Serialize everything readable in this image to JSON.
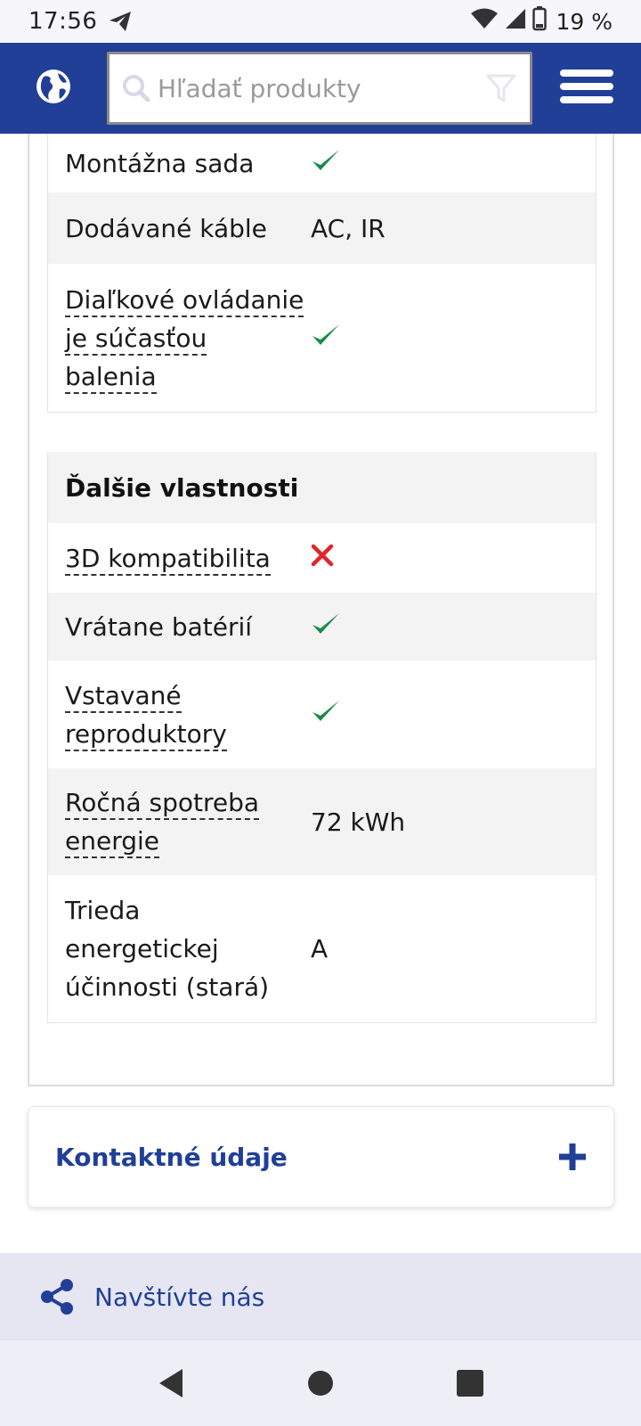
{
  "status_bar": {
    "time": "17:56",
    "battery": "19 %"
  },
  "header": {
    "search_placeholder": "Hľadať produkty",
    "brand_color": "#213f97"
  },
  "table1": {
    "rows": [
      {
        "label": "Montážna sada",
        "value": "check"
      },
      {
        "label": "Dodávané káble",
        "value": "AC, IR"
      },
      {
        "label_lines": [
          "Diaľkové ovládanie",
          "je súčasťou",
          "balenia"
        ],
        "value": "check"
      }
    ]
  },
  "table2": {
    "title": "Ďalšie vlastnosti",
    "rows": [
      {
        "label": "3D kompatibilita",
        "value": "cross"
      },
      {
        "label": "Vrátane batérií",
        "value": "check"
      },
      {
        "label_lines": [
          "Vstavané",
          "reproduktory"
        ],
        "value": "check"
      },
      {
        "label_lines": [
          "Ročná spotreba",
          "energie"
        ],
        "value": "72 kWh"
      },
      {
        "label_lines": [
          "Trieda",
          "energetickej",
          "účinnosti (stará)"
        ],
        "value": "A"
      }
    ]
  },
  "contact": {
    "title": "Kontaktné údaje"
  },
  "footer": {
    "visit_label": "Navštívte nás"
  },
  "icons": {
    "check_color": "#1a8a4a",
    "cross_color": "#e0252c"
  }
}
